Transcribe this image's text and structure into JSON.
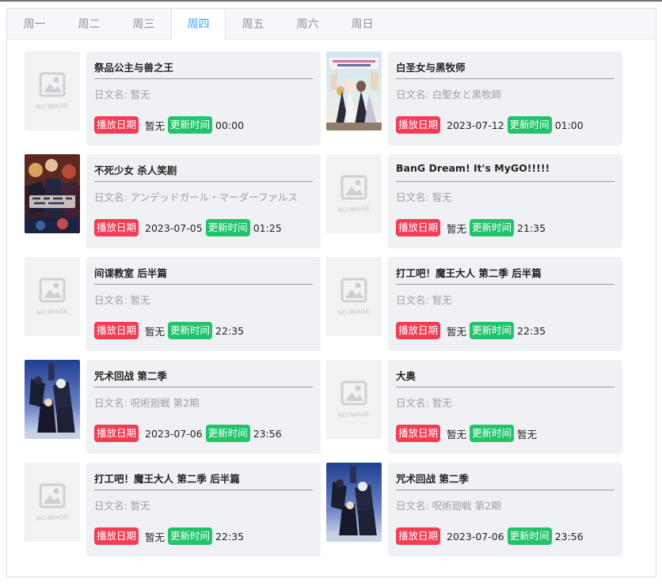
{
  "tabs": [
    {
      "label": "周一",
      "active": false
    },
    {
      "label": "周二",
      "active": false
    },
    {
      "label": "周三",
      "active": false
    },
    {
      "label": "周四",
      "active": true
    },
    {
      "label": "周五",
      "active": false
    },
    {
      "label": "周六",
      "active": false
    },
    {
      "label": "周日",
      "active": false
    }
  ],
  "labels": {
    "jp_prefix": "日文名: ",
    "air_date": "播放日期",
    "update_time": "更新时间"
  },
  "noimage_text": "NO IMAGE",
  "colors": {
    "active_tab": "#409eff",
    "air_tag": "#f23d55",
    "update_tag": "#21c46a",
    "card_bg": "#f0f1f5"
  },
  "items": [
    {
      "title": "祭品公主与兽之王",
      "jp": "日文名: 暂无",
      "date": "暂无",
      "time": "00:00",
      "cover": "noimage"
    },
    {
      "title": "白圣女与黑牧师",
      "jp": "日文名: 白聖女と黒牧師",
      "date": "2023-07-12",
      "time": "01:00",
      "cover": "shiro"
    },
    {
      "title": "不死少女 杀人笑剧",
      "jp": "日文名: アンデッドガール・マーダーファルス",
      "date": "2023-07-05",
      "time": "01:25",
      "cover": "undead"
    },
    {
      "title": "BanG Dream! It's MyGO!!!!!",
      "jp": "日文名: 暂无",
      "date": "暂无",
      "time": "21:35",
      "cover": "noimage"
    },
    {
      "title": "间谍教室 后半篇",
      "jp": "日文名: 暂无",
      "date": "暂无",
      "time": "22:35",
      "cover": "noimage"
    },
    {
      "title": "打工吧！魔王大人 第二季 后半篇",
      "jp": "日文名: 暂无",
      "date": "暂无",
      "time": "22:35",
      "cover": "noimage"
    },
    {
      "title": "咒术回战 第二季",
      "jp": "日文名: 呪術廻戦 第2期",
      "date": "2023-07-06",
      "time": "23:56",
      "cover": "jjk"
    },
    {
      "title": "大奥",
      "jp": "日文名: 暂无",
      "date": "暂无",
      "time": "暂无",
      "cover": "noimage"
    },
    {
      "title": "打工吧！魔王大人 第二季 后半篇",
      "jp": "日文名: 暂无",
      "date": "暂无",
      "time": "22:35",
      "cover": "noimage"
    },
    {
      "title": "咒术回战 第二季",
      "jp": "日文名: 呪術廻戦 第2期",
      "date": "2023-07-06",
      "time": "23:56",
      "cover": "jjk"
    }
  ]
}
